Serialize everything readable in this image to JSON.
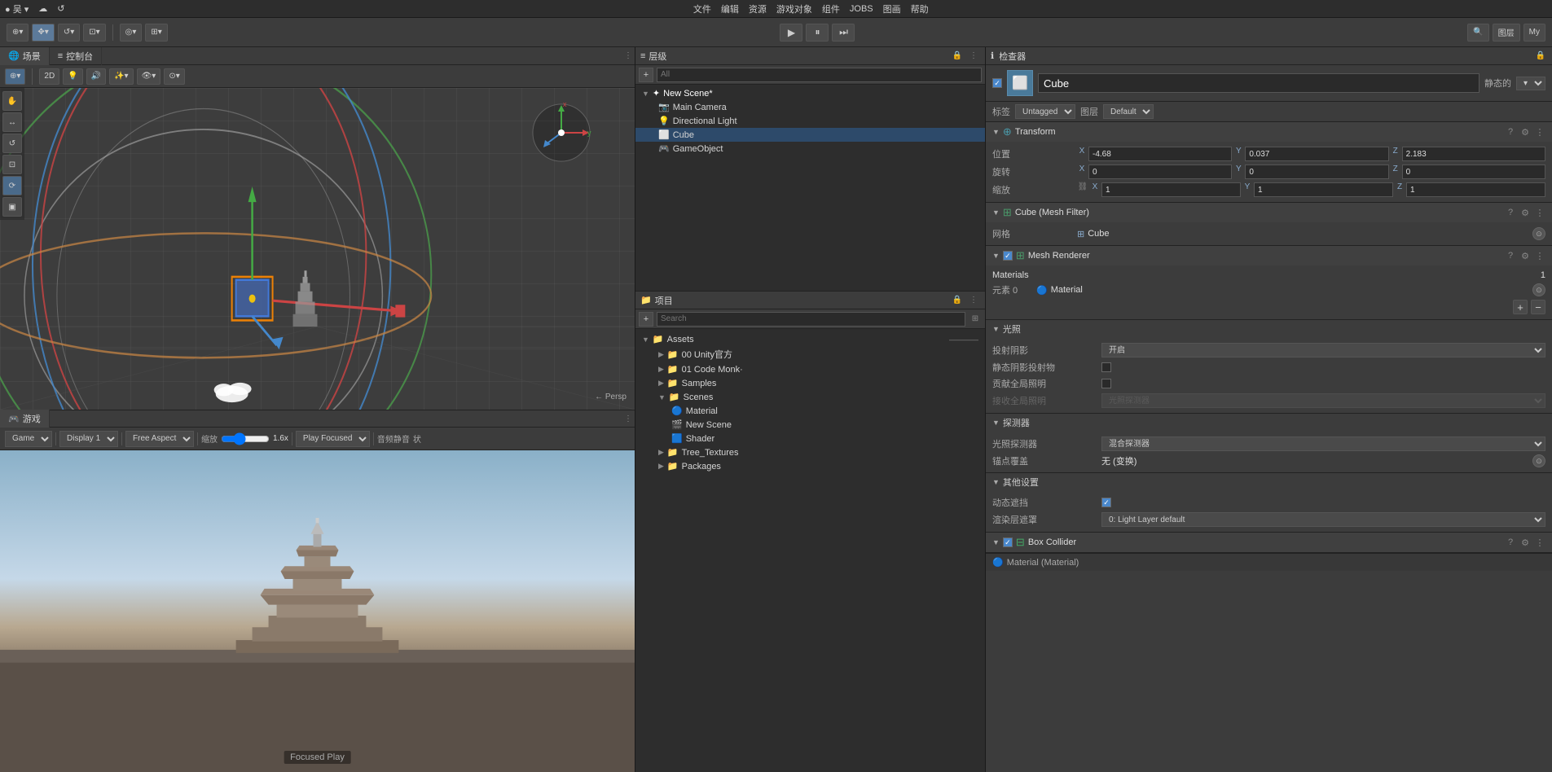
{
  "menubar": {
    "items": [
      "文件",
      "编辑",
      "资源",
      "游戏对象",
      "组件",
      "JOBS",
      "图画",
      "帮助"
    ]
  },
  "toolbar": {
    "user": "吴",
    "cloud_icon": "☁",
    "history_icon": "↺",
    "search_icon": "🔍",
    "layers_label": "图层",
    "layout_label": "My",
    "play_label": "▶",
    "pause_label": "⏸",
    "step_label": "⏭"
  },
  "scene_tab": {
    "label": "场景",
    "console_label": "控制台"
  },
  "scene_toolbar": {
    "transform_modes": [
      "⊕",
      "2D",
      "💡",
      "🔊",
      "🔄",
      "👁",
      "📷"
    ],
    "persp_label": "← Persp"
  },
  "scene_left_icons": [
    "↔",
    "↕",
    "↺",
    "⊡",
    "⟳",
    "▣"
  ],
  "game_tab": {
    "label": "游戏",
    "display": "Display 1",
    "aspect": "Free Aspect",
    "scale_label": "缩放",
    "scale_value": "1.6x",
    "play_focused_label": "Play Focused",
    "focused_play_label": "Focused Play",
    "free_aspect_label": "Free Aspect",
    "audio_label": "音频静音",
    "status_label": "状"
  },
  "hierarchy": {
    "title": "层级",
    "search_placeholder": "All",
    "new_scene_label": "New Scene*",
    "items": [
      {
        "name": "Main Camera",
        "icon": "📷",
        "indent": 1
      },
      {
        "name": "Directional Light",
        "icon": "💡",
        "indent": 1
      },
      {
        "name": "Cube",
        "icon": "⬜",
        "indent": 1,
        "selected": true
      },
      {
        "name": "GameObject",
        "icon": "🎮",
        "indent": 1
      }
    ]
  },
  "project": {
    "title": "项目",
    "assets_label": "Assets",
    "items": [
      {
        "type": "folder",
        "name": "00 Unity官方",
        "indent": 1,
        "expanded": false
      },
      {
        "type": "folder",
        "name": "01 Code Monk·",
        "indent": 1,
        "expanded": false
      },
      {
        "type": "folder",
        "name": "Samples",
        "indent": 1,
        "expanded": false
      },
      {
        "type": "folder",
        "name": "Scenes",
        "indent": 1,
        "expanded": true
      },
      {
        "type": "material",
        "name": "Material",
        "indent": 2
      },
      {
        "type": "scene",
        "name": "New Scene",
        "indent": 2
      },
      {
        "type": "shader",
        "name": "Shader",
        "indent": 2
      },
      {
        "type": "folder",
        "name": "Tree_Textures",
        "indent": 1,
        "expanded": false
      },
      {
        "type": "folder",
        "name": "Packages",
        "indent": 1,
        "expanded": false
      }
    ]
  },
  "inspector": {
    "title": "检查器",
    "object_name": "Cube",
    "static_label": "静态的",
    "tag_label": "标签",
    "tag_value": "Untagged",
    "layer_label": "图层",
    "layer_value": "Default",
    "transform": {
      "name": "Transform",
      "pos_label": "位置",
      "pos_x": "-4.68",
      "pos_y": "0.037",
      "pos_z": "2.183",
      "rot_label": "旋转",
      "rot_x": "0",
      "rot_y": "0",
      "rot_z": "0",
      "scale_label": "缩放",
      "scale_x": "1",
      "scale_y": "1",
      "scale_z": "1"
    },
    "mesh_filter": {
      "name": "Cube (Mesh Filter)",
      "mesh_label": "网格",
      "mesh_value": "Cube"
    },
    "mesh_renderer": {
      "name": "Mesh Renderer",
      "materials_label": "Materials",
      "materials_count": "1",
      "element_label": "元素 0",
      "material_name": "Material"
    },
    "lighting": {
      "section_label": "光照",
      "cast_shadows_label": "投射阴影",
      "cast_shadows_value": "开启",
      "static_shadow_label": "静态阴影投射物",
      "contribute_gi_label": "贡献全局照明",
      "receive_gi_label": "接收全局照明",
      "receive_gi_value": "光照探测器"
    },
    "probes": {
      "section_label": "探测器",
      "light_probes_label": "光照探测器",
      "light_probes_value": "混合探测器",
      "anchor_label": "锚点覆盖",
      "anchor_value": "无 (变换)"
    },
    "additional": {
      "section_label": "其他设置",
      "dynamic_occlusion_label": "动态遮挡",
      "render_layer_label": "渲染层遮罩",
      "render_layer_value": "0: Light Layer default"
    },
    "box_collider": {
      "name": "Box Collider"
    }
  }
}
